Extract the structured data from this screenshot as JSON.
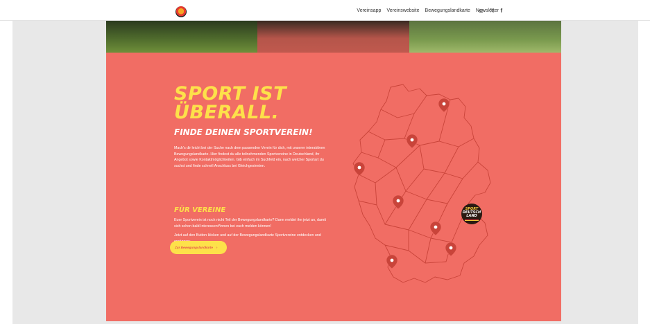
{
  "header": {
    "logo_name": "sportdeutschland-logo",
    "nav": [
      {
        "label": "Vereinsapp"
      },
      {
        "label": "Vereinswebsite"
      },
      {
        "label": "Bewegungslandkarte"
      },
      {
        "label": "Newsletter"
      }
    ],
    "social": [
      {
        "icon": "instagram-icon",
        "glyph": "◎"
      },
      {
        "icon": "x-icon",
        "glyph": "𝕏"
      },
      {
        "icon": "facebook-icon",
        "glyph": "f"
      }
    ]
  },
  "hero": {
    "headline_line1": "SPORT IST",
    "headline_line2": "ÜBERALL.",
    "subheadline": "FINDE DEINEN SPORTVEREIN!",
    "paragraph1": "Mach's dir leicht bei der Suche nach dem passenden Verein für dich, mit unserer interaktiven Bewegungslandkarte. Hier findest du alle teilnehmenden Sportvereine in Deutschland, ihr Angebot sowie Kontaktmöglichkeiten. Gib einfach im Suchfeld ein, nach welcher Sportart du suchst und finde schnell Anschluss bei Gleichgesinnten.",
    "section_title": "FÜR VEREINE",
    "paragraph2": "Euer Sportverein ist noch nicht Teil der Bewegungslandkarte? Dann meldet ihn jetzt an, damit sich schon bald Interessent*innen bei euch melden können!",
    "paragraph3": "Jetzt auf den Button klicken und auf der Bewegungslandkarte Sportvereine entdecken und ergänzen:",
    "cta_label": "Zur Bewegungslandkarte",
    "cta_arrow": "›"
  },
  "badge": {
    "line1": "SPORT",
    "line2": "DEUTSCH",
    "line3": "LAND"
  },
  "colors": {
    "panel": "#f16d64",
    "headline": "#fde14a",
    "pin": "#c9443a"
  }
}
